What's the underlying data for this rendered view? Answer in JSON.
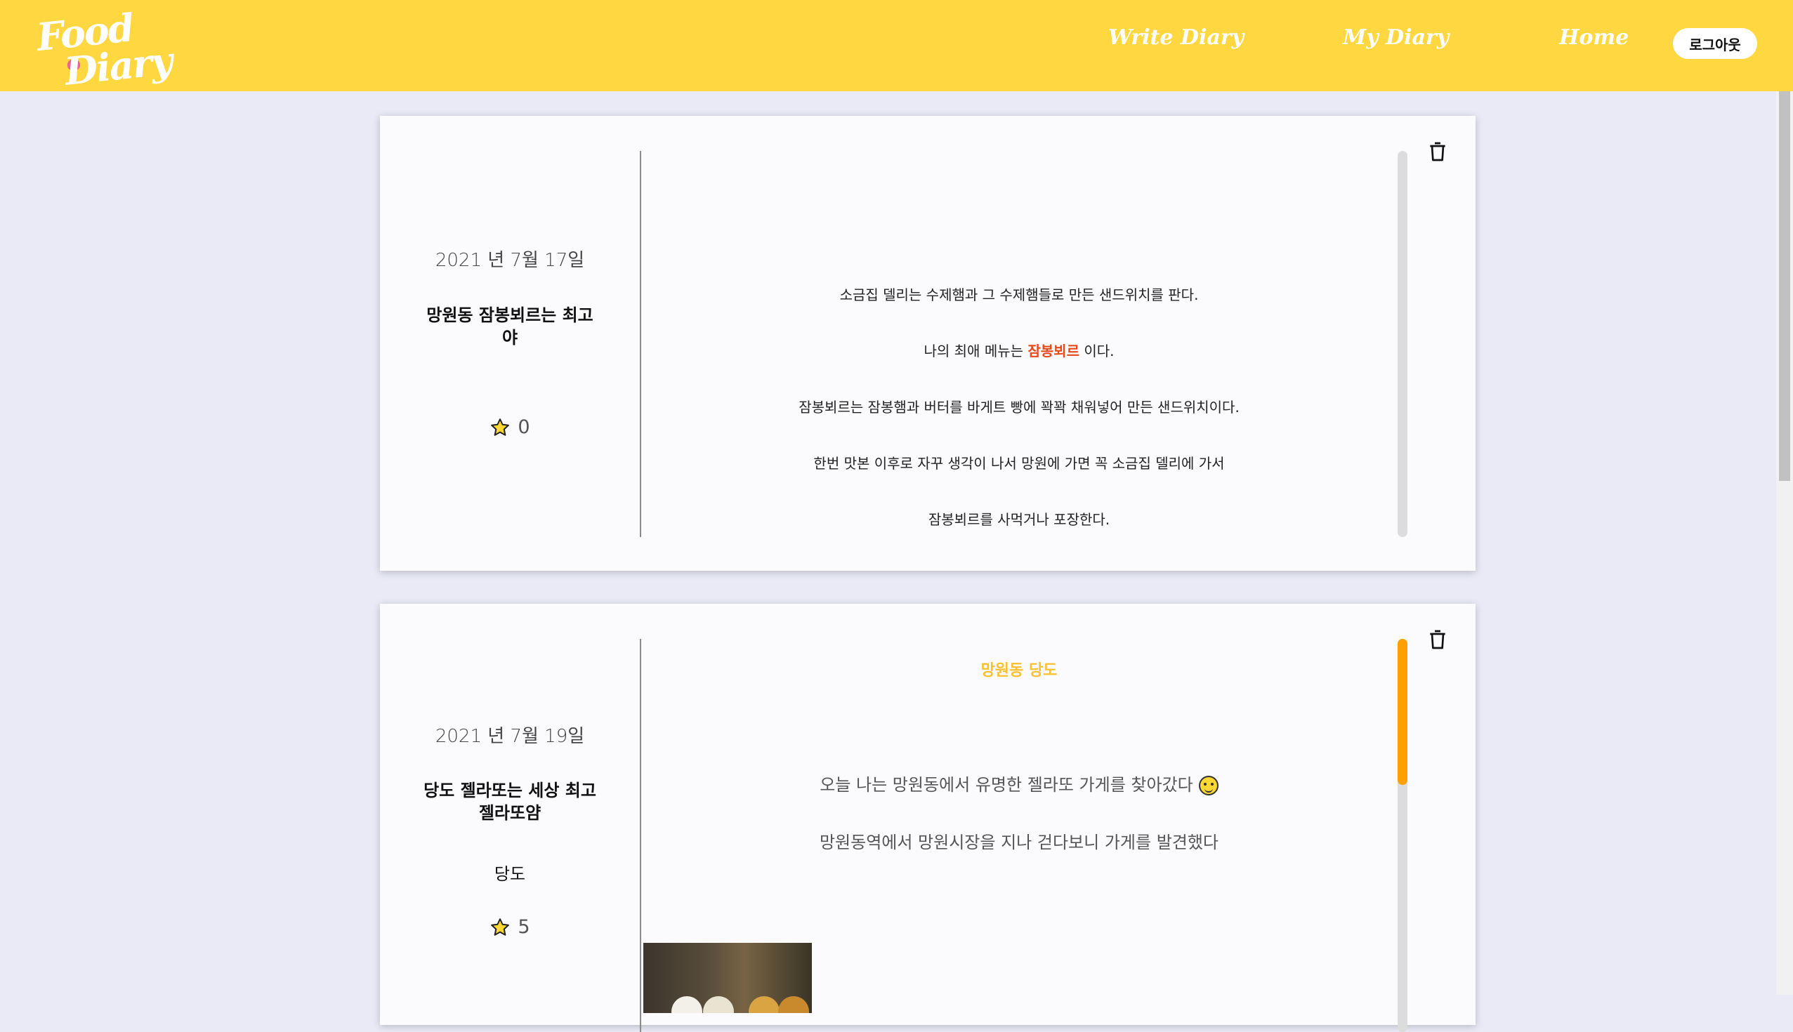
{
  "header": {
    "logo_line1": "Food",
    "logo_line2": "Diary",
    "nav": {
      "write": "Write Diary",
      "my": "My Diary",
      "home": "Home"
    },
    "logout": "로그아웃",
    "background_color": "#ffd740"
  },
  "entries": [
    {
      "date": "2021 년 7월 17일",
      "title": "망원동 잠봉뵈르는 최고야",
      "place": "",
      "rating": "0",
      "content": {
        "line1": "소금집 델리는 수제햄과 그 수제햄들로 만든 샌드위치를 판다.",
        "line2_before": "나의 최애 메뉴는 ",
        "line2_highlight": "잠봉뵈르",
        "line2_after": " 이다.",
        "line3": "잠봉뵈르는 잠봉햄과 버터를 바게트 빵에 꽉꽉 채워넣어 만든 샌드위치이다.",
        "line4": "한번 맛본 이후로 자꾸 생각이 나서 망원에 가면 꼭 소금집 델리에 가서",
        "line5": "잠봉뵈르를 사먹거나 포장한다."
      },
      "highlight_color": "#e64a19"
    },
    {
      "date": "2021 년 7월 19일",
      "title": "당도 젤라또는 세상 최고 젤라또얌",
      "place": "당도",
      "rating": "5",
      "content": {
        "heading": "망원동 당도",
        "line1": "오늘 나는 망원동에서 유명한 젤라또 가게를 찾아갔다",
        "line2": "망원동역에서 망원시장을 지나 걷다보니 가게를 발견했다"
      },
      "heading_color": "#fbc02d",
      "scroll_color": "#ffa000"
    }
  ],
  "icons": {
    "star": "star-icon",
    "trash": "trash-icon",
    "emoji": "grinning-face-icon"
  }
}
